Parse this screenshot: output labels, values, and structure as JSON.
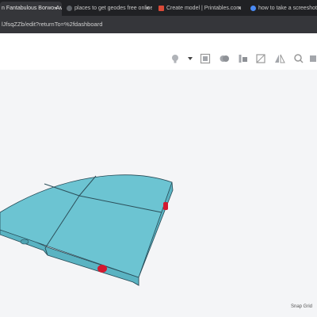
{
  "browser": {
    "tabs": [
      {
        "title": "n Fantabulous Borwo-Ам",
        "icon": "tinkercad-icon",
        "color": "#e8612c",
        "active": true
      },
      {
        "title": "places to get geodes free online !",
        "icon": "search-icon",
        "color": "#5f6368",
        "active": false
      },
      {
        "title": "Create model | Printables.com",
        "icon": "printables-icon",
        "color": "#d94a38",
        "active": false
      },
      {
        "title": "how to take a screeshot - Se",
        "icon": "search-icon",
        "color": "#4a8af4",
        "active": false
      }
    ],
    "close_glyph": "×",
    "url": "lJfsqZZb/edit?returnTo=%2fdashboard"
  },
  "toolbar": {
    "icons": [
      "lightbulb-icon",
      "dropdown-icon",
      "group-icon",
      "shapes-icon",
      "align-icon",
      "mirror-icon",
      "flip-icon",
      "ruler-icon"
    ]
  },
  "workplane": {
    "snap_label": "Snap Grid"
  },
  "colors": {
    "shape_top": "#6cc4d2",
    "shape_side": "#5ab3c2",
    "shape_edge": "#274a56",
    "marker": "#d3182f"
  }
}
